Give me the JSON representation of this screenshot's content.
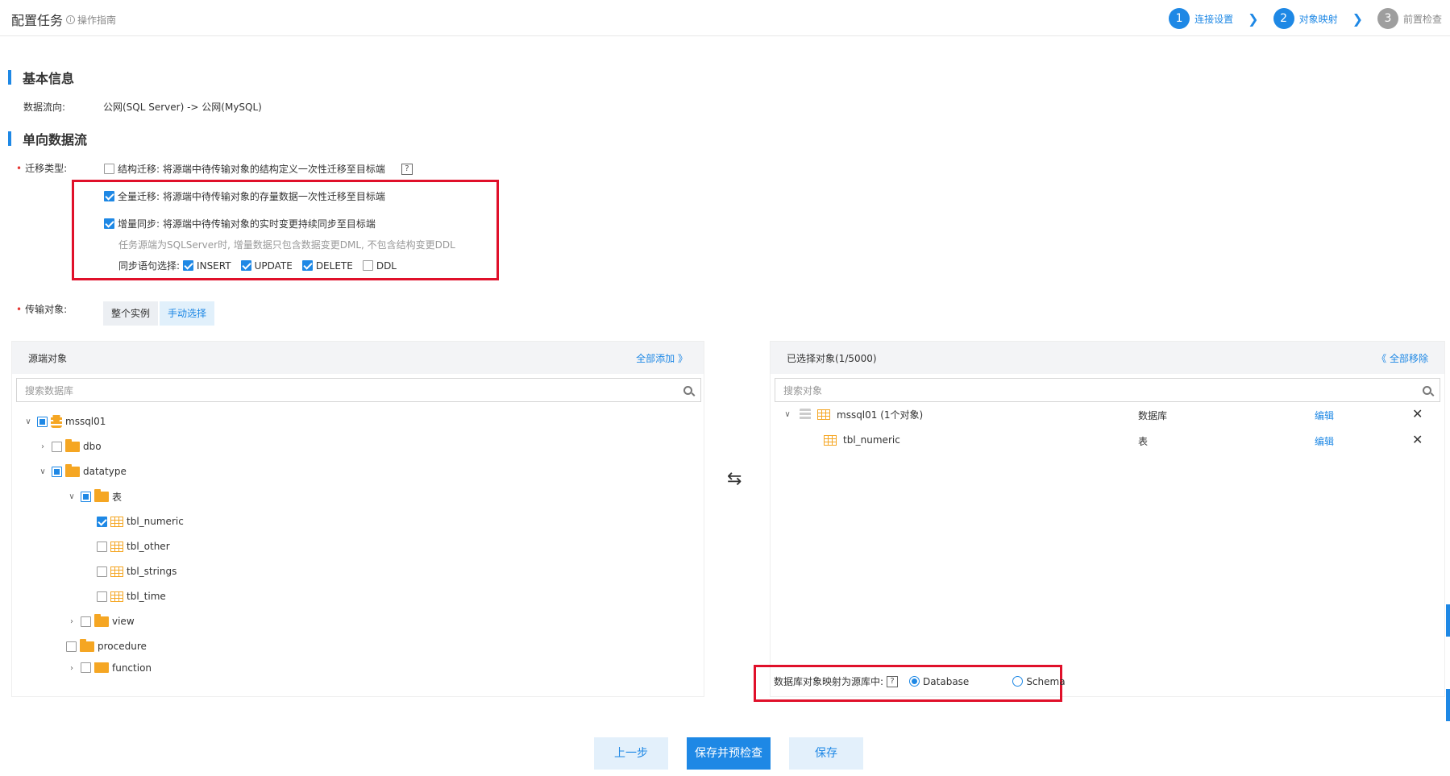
{
  "header": {
    "title": "配置任务",
    "guide": "操作指南",
    "steps": [
      {
        "num": "1",
        "label": "连接设置"
      },
      {
        "num": "2",
        "label": "对象映射"
      },
      {
        "num": "3",
        "label": "前置检查"
      }
    ]
  },
  "basic": {
    "heading": "基本信息",
    "flow_label": "数据流向:",
    "flow_value": "公网(SQL Server) -> 公网(MySQL)"
  },
  "oneway": {
    "heading": "单向数据流",
    "migrate_label": "迁移类型:",
    "structure": "结构迁移: 将源端中待传输对象的结构定义一次性迁移至目标端",
    "full": "全量迁移: 将源端中待传输对象的存量数据一次性迁移至目标端",
    "incremental": "增量同步: 将源端中待传输对象的实时变更持续同步至目标端",
    "note": "任务源端为SQLServer时, 增量数据只包含数据变更DML, 不包含结构变更DDL",
    "sync_label": "同步语句选择:",
    "sync_options": {
      "insert": "INSERT",
      "update": "UPDATE",
      "delete": "DELETE",
      "ddl": "DDL"
    },
    "q": "?",
    "transfer_label": "传输对象:",
    "whole": "整个实例",
    "manual": "手动选择"
  },
  "source": {
    "title": "源端对象",
    "add_all": "全部添加 》",
    "search_placeholder": "搜索数据库",
    "tree": {
      "root": "mssql01",
      "dbo": "dbo",
      "datatype": "datatype",
      "tables": "表",
      "t1": "tbl_numeric",
      "t2": "tbl_other",
      "t3": "tbl_strings",
      "t4": "tbl_time",
      "view": "view",
      "procedure": "procedure",
      "function": "function"
    }
  },
  "selected": {
    "title": "已选择对象(1/5000)",
    "remove_all": "《 全部移除",
    "search_placeholder": "搜索对象",
    "rows": [
      {
        "name": "mssql01 (1个对象)",
        "type": "数据库",
        "edit": "编辑"
      },
      {
        "name": "tbl_numeric",
        "type": "表",
        "edit": "编辑"
      }
    ],
    "mapping_label": "数据库对象映射为源库中:",
    "opt_database": "Database",
    "opt_schema": "Schema"
  },
  "buttons": {
    "prev": "上一步",
    "save_check": "保存并预检查",
    "save": "保存"
  }
}
